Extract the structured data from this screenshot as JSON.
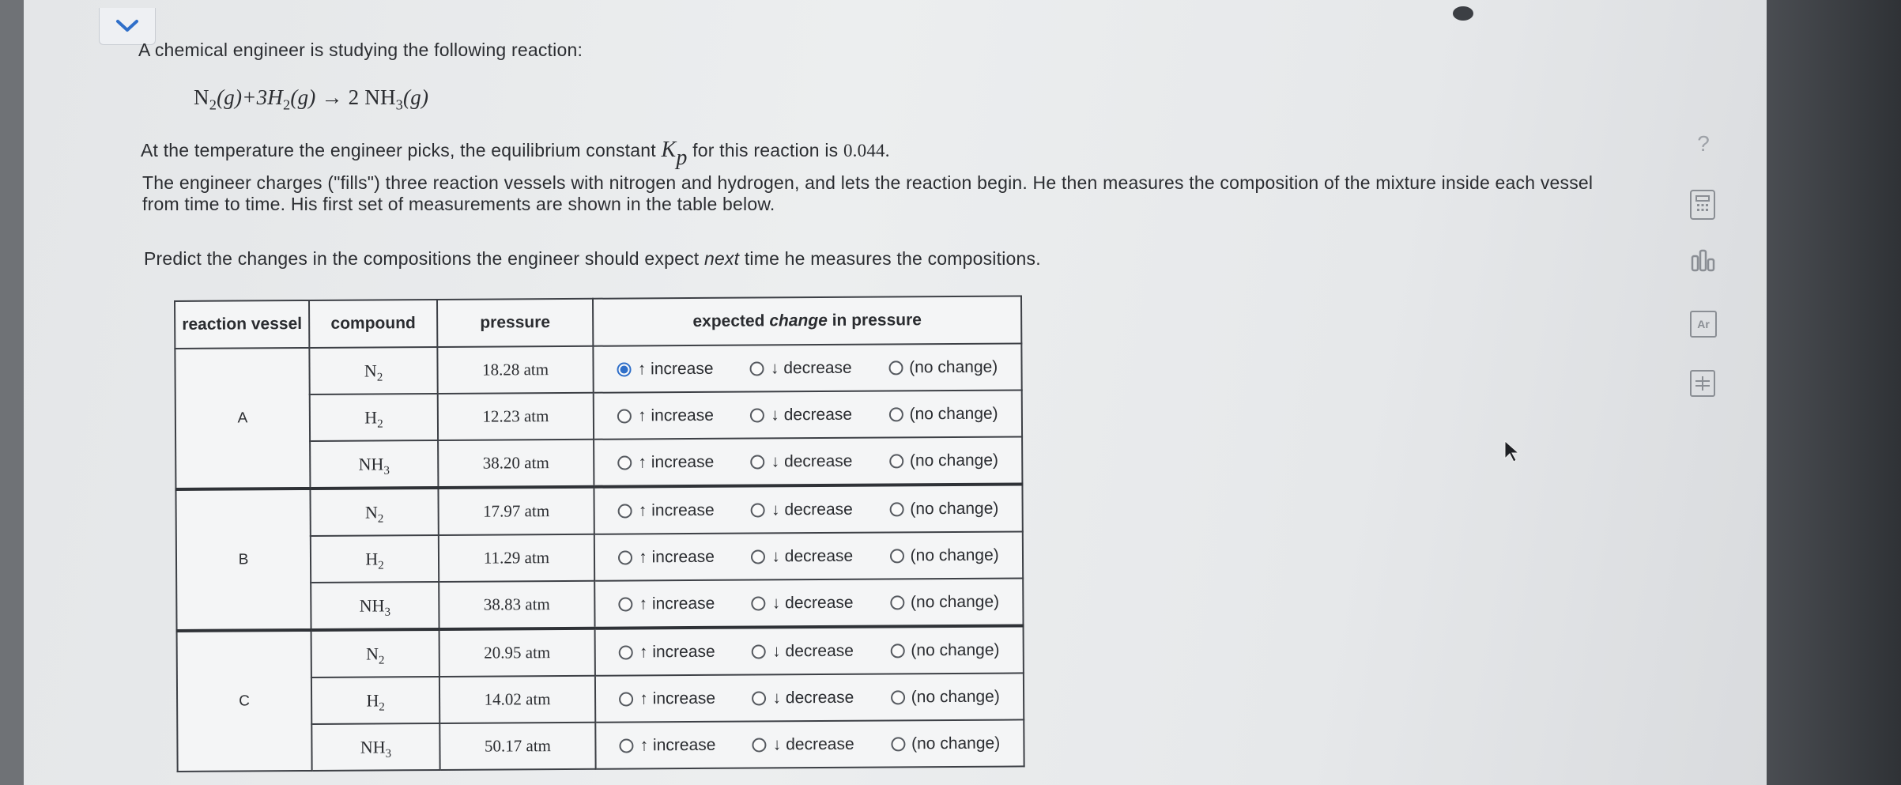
{
  "question": {
    "intro": "A chemical engineer is studying the following reaction:",
    "equation": {
      "r1": "N",
      "r1_sub": "2",
      "r1_state": "(g)+3H",
      "r2_sub": "2",
      "r2_state": "(g)",
      "arrow": "→",
      "p_coef": "2 NH",
      "p_sub": "3",
      "p_state": "(g)"
    },
    "kp_text_before": "At the temperature the engineer picks, the equilibrium constant ",
    "kp_symbol": "K",
    "kp_sub": "p",
    "kp_text_after": " for this reaction is ",
    "kp_value": "0.044.",
    "description": "The engineer charges (\"fills\") three reaction vessels with nitrogen and hydrogen, and lets the reaction begin. He then measures the composition of the mixture inside each vessel from time to time. His first set of measurements are shown in the table below.",
    "prompt_before": "Predict the changes in the compositions the engineer should expect ",
    "prompt_emph": "next",
    "prompt_after": " time he measures the compositions."
  },
  "table": {
    "headers": {
      "vessel": "reaction vessel",
      "compound": "compound",
      "pressure": "pressure",
      "expected_before": "expected ",
      "expected_emph": "change",
      "expected_after": " in pressure"
    },
    "option_labels": {
      "increase": "↑ increase",
      "decrease": "↓ decrease",
      "nochange": "(no change)"
    },
    "rows": [
      {
        "vessel": "A",
        "compound": "N",
        "sub": "2",
        "pressure": "18.28 atm",
        "selected": "increase"
      },
      {
        "vessel": "A",
        "compound": "H",
        "sub": "2",
        "pressure": "12.23 atm",
        "selected": ""
      },
      {
        "vessel": "A",
        "compound": "NH",
        "sub": "3",
        "pressure": "38.20 atm",
        "selected": ""
      },
      {
        "vessel": "B",
        "compound": "N",
        "sub": "2",
        "pressure": "17.97 atm",
        "selected": ""
      },
      {
        "vessel": "B",
        "compound": "H",
        "sub": "2",
        "pressure": "11.29 atm",
        "selected": ""
      },
      {
        "vessel": "B",
        "compound": "NH",
        "sub": "3",
        "pressure": "38.83 atm",
        "selected": ""
      },
      {
        "vessel": "C",
        "compound": "N",
        "sub": "2",
        "pressure": "20.95 atm",
        "selected": ""
      },
      {
        "vessel": "C",
        "compound": "H",
        "sub": "2",
        "pressure": "14.02 atm",
        "selected": ""
      },
      {
        "vessel": "C",
        "compound": "NH",
        "sub": "3",
        "pressure": "50.17 atm",
        "selected": ""
      }
    ]
  },
  "tools": {
    "help": "?",
    "periodic": "Ar"
  }
}
